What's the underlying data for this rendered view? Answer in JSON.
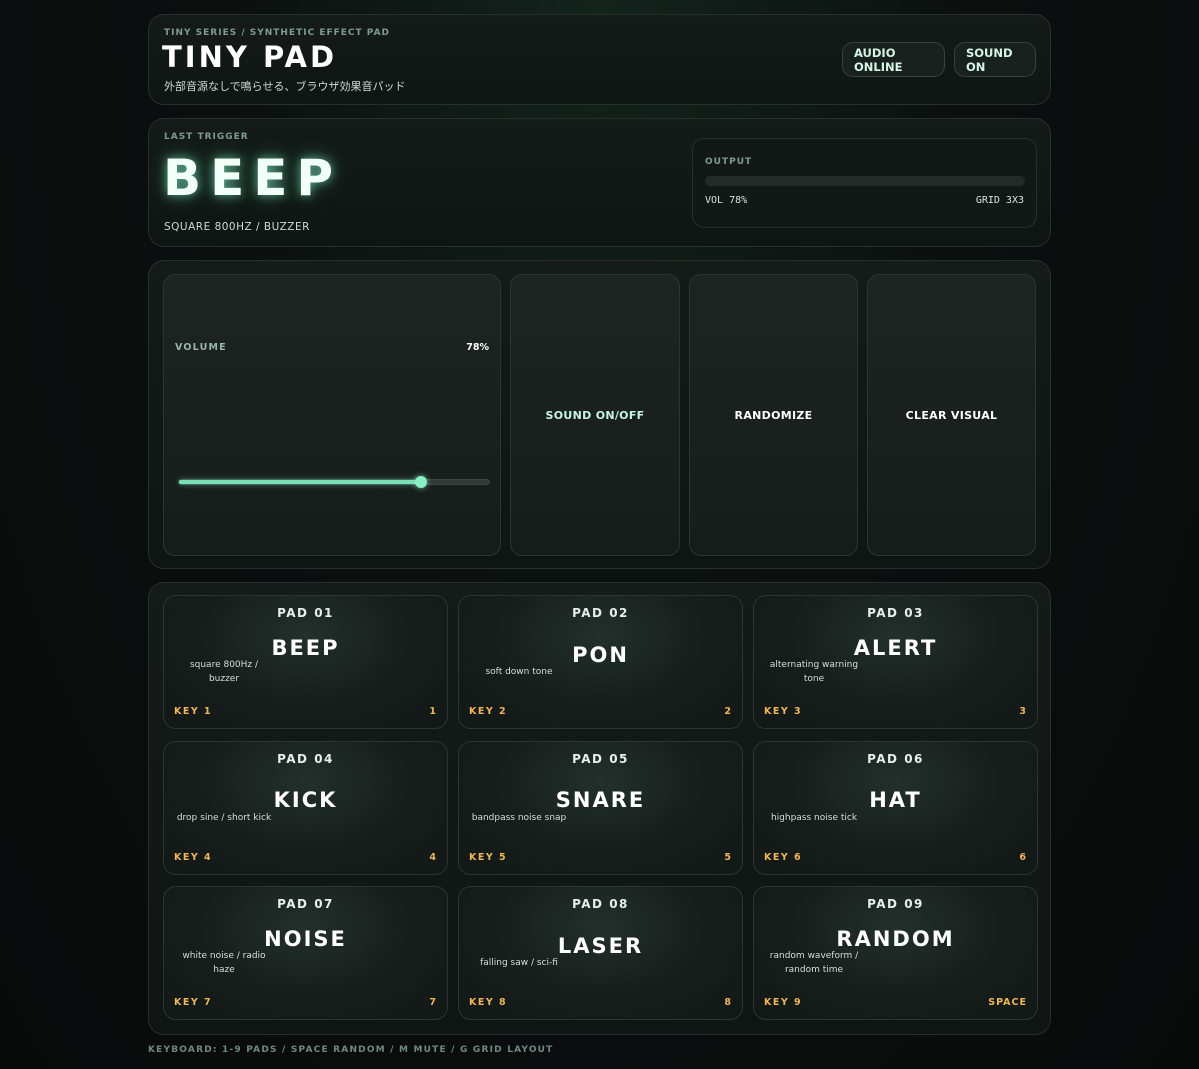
{
  "header": {
    "eyebrow": "TINY SERIES / SYNTHETIC EFFECT PAD",
    "title": "TINY PAD",
    "subtitle": "外部音源なしで鳴らせる、ブラウザ効果音パッド",
    "audio_status": "AUDIO ONLINE",
    "sound_status": "SOUND ON"
  },
  "trigger": {
    "label": "LAST TRIGGER",
    "name": "BEEP",
    "detail": "SQUARE 800HZ / BUZZER"
  },
  "output": {
    "label": "OUTPUT",
    "volume_text": "VOL 78%",
    "grid_text": "GRID 3X3",
    "level_percent": 0
  },
  "controls": {
    "volume_label": "VOLUME",
    "volume_value": "78%",
    "volume_percent": 78,
    "sound_toggle": "SOUND ON/OFF",
    "randomize": "RANDOMIZE",
    "clear_visual": "CLEAR VISUAL"
  },
  "pads": [
    {
      "num": "PAD 01",
      "name": "BEEP",
      "desc": "square 800Hz / buzzer",
      "key": "KEY 1",
      "hotkey": "1"
    },
    {
      "num": "PAD 02",
      "name": "PON",
      "desc": "soft down tone",
      "key": "KEY 2",
      "hotkey": "2"
    },
    {
      "num": "PAD 03",
      "name": "ALERT",
      "desc": "alternating warning tone",
      "key": "KEY 3",
      "hotkey": "3"
    },
    {
      "num": "PAD 04",
      "name": "KICK",
      "desc": "drop sine / short kick",
      "key": "KEY 4",
      "hotkey": "4"
    },
    {
      "num": "PAD 05",
      "name": "SNARE",
      "desc": "bandpass noise snap",
      "key": "KEY 5",
      "hotkey": "5"
    },
    {
      "num": "PAD 06",
      "name": "HAT",
      "desc": "highpass noise tick",
      "key": "KEY 6",
      "hotkey": "6"
    },
    {
      "num": "PAD 07",
      "name": "NOISE",
      "desc": "white noise / radio haze",
      "key": "KEY 7",
      "hotkey": "7"
    },
    {
      "num": "PAD 08",
      "name": "LASER",
      "desc": "falling saw / sci-fi",
      "key": "KEY 8",
      "hotkey": "8"
    },
    {
      "num": "PAD 09",
      "name": "RANDOM",
      "desc": "random waveform / random time",
      "key": "KEY 9",
      "hotkey": "SPACE"
    }
  ],
  "footer": "KEYBOARD: 1-9 PADS / SPACE RANDOM / M MUTE / G GRID LAYOUT",
  "colors": {
    "accent": "#7be0b5",
    "key": "#f0b65a"
  }
}
